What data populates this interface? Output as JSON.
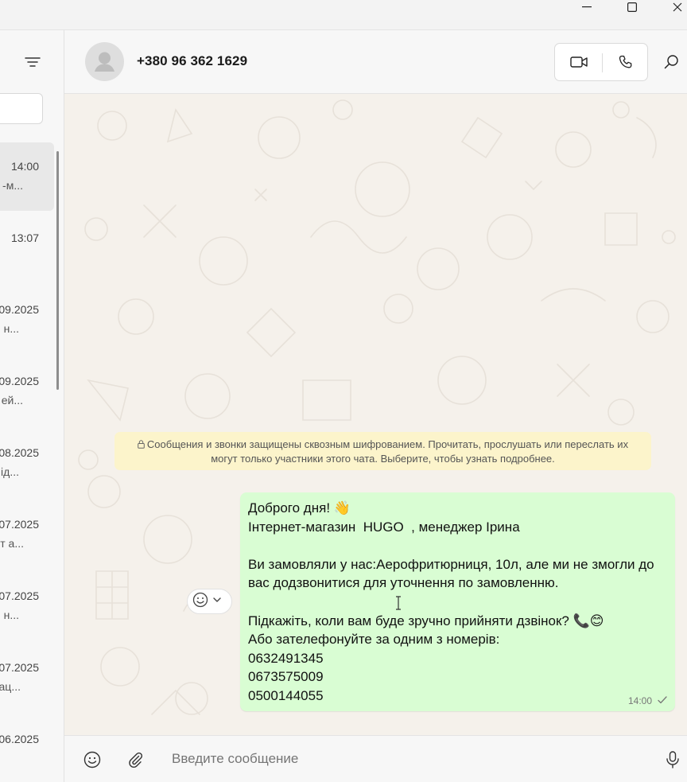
{
  "window_controls": [
    "minimize-icon",
    "maximize-icon",
    "close-icon"
  ],
  "sidebar": {
    "filter_icon": "filter-icon",
    "chats": [
      {
        "time": "14:00",
        "preview": "-м...",
        "active": true
      },
      {
        "time": "13:07",
        "preview": ""
      },
      {
        "time": "09.2025",
        "preview": "н..."
      },
      {
        "time": "09.2025",
        "preview": "ей..."
      },
      {
        "time": "08.2025",
        "preview": "ід..."
      },
      {
        "time": "07.2025",
        "preview": "т а..."
      },
      {
        "time": "07.2025",
        "preview": "н..."
      },
      {
        "time": "07.2025",
        "preview": "ац..."
      },
      {
        "time": "06.2025",
        "preview": ""
      }
    ]
  },
  "header": {
    "contact_name": "+380 96 362 1629",
    "icons": [
      "avatar-placeholder-icon",
      "video-call-icon",
      "voice-call-icon",
      "search-icon"
    ]
  },
  "encryption_notice": {
    "icon": "lock-icon",
    "line1": "Сообщения и звонки защищены сквозным шифрованием. Прочитать, прослушать или переслать их",
    "line2": "могут только участники этого чата. Выберите, чтобы узнать подробнее."
  },
  "message": {
    "lines": [
      "Доброго дня! 👋",
      "Інтернет-магазин  HUGO  , менеджер Ірина",
      "",
      "Ви замовляли у нас:Аерофритюрниця, 10л, але ми не змогли до",
      "вас додзвонитися для уточнення по замовленню.",
      "",
      "Підкажіть, коли вам буде зручно прийняти дзвінок? 📞😊",
      "Або зателефонуйте за одним з номерів:",
      "0632491345",
      "0673575009",
      "0500144055"
    ],
    "time": "14:00",
    "status_icon": "single-check-icon"
  },
  "reaction": {
    "icons": [
      "emoji-react-icon",
      "chevron-down-icon"
    ]
  },
  "composer": {
    "placeholder": "Введите сообщение",
    "icons": [
      "emoji-icon",
      "attach-icon",
      "microphone-icon"
    ]
  },
  "colors": {
    "outgoing_bubble": "#d9fdd3",
    "chat_background": "#f5f1eb",
    "notice_background": "#fcf4cb",
    "panel": "#f7f7f7"
  }
}
